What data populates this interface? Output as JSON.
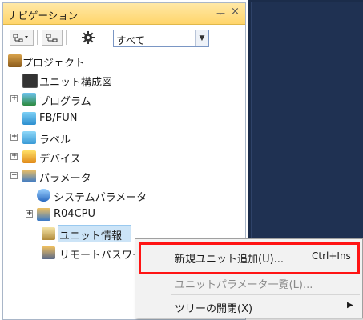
{
  "nav": {
    "title": "ナビゲーション",
    "pin": "ᅮ",
    "close": "×",
    "filter_value": "すべて"
  },
  "tree": [
    {
      "label": "プロジェクト"
    },
    {
      "label": "ユニット構成図"
    },
    {
      "label": "プログラム"
    },
    {
      "label": "FB/FUN"
    },
    {
      "label": "ラベル"
    },
    {
      "label": "デバイス"
    },
    {
      "label": "パラメータ"
    },
    {
      "label": "システムパラメータ"
    },
    {
      "label": "R04CPU"
    },
    {
      "label": "ユニット情報"
    },
    {
      "label": "リモートパスワー"
    }
  ],
  "context_menu": [
    {
      "label": "新規ユニット追加(U)...",
      "shortcut": "Ctrl+Ins"
    },
    {
      "label": "ユニットパラメータ一覧(L)..."
    },
    {
      "label": "ツリーの開閉(X)",
      "arrow": "▶"
    }
  ],
  "colors": {
    "title_bar": "#ffd56b",
    "selection": "#cce4f7",
    "highlight": "#ff1414",
    "right_panel": "#1f3152"
  }
}
